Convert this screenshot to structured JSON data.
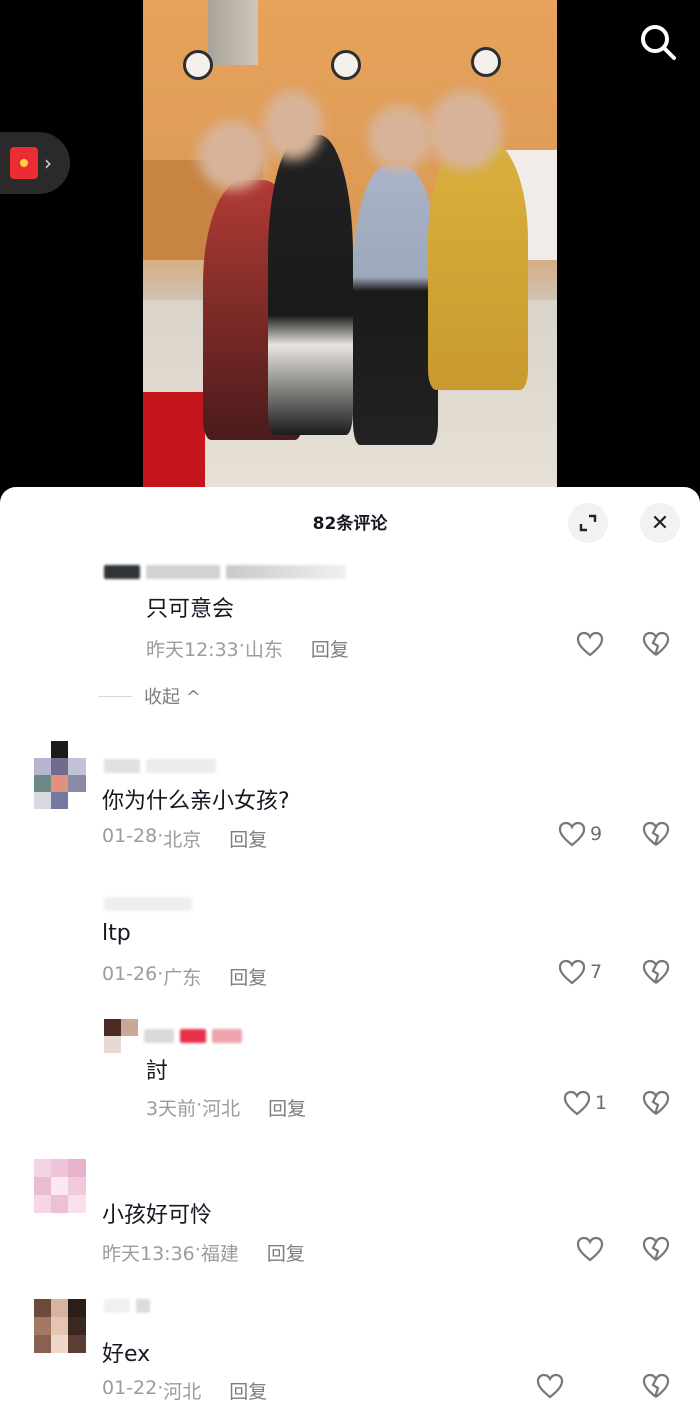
{
  "video": {
    "search_icon": "search-icon",
    "red_packet_icon": "red-envelope-icon"
  },
  "sheet": {
    "title": "82条评论",
    "expand_icon": "expand-icon",
    "close_icon": "close-icon",
    "close_glyph": "✕",
    "collapse_label": "收起 ^"
  },
  "comments": [
    {
      "text": "只可意会",
      "time": "昨天12:33",
      "location": "山东",
      "reply": "回复",
      "likes": ""
    },
    {
      "text": "你为什么亲小女孩?",
      "time": "01-28",
      "location": "北京",
      "reply": "回复",
      "likes": "9"
    },
    {
      "text": "ltp",
      "time": "01-26",
      "location": "广东",
      "reply": "回复",
      "likes": "7"
    },
    {
      "text": "討",
      "time": "3天前",
      "location": "河北",
      "reply": "回复",
      "likes": "1"
    },
    {
      "text": "小孩好可怜",
      "time": "昨天13:36",
      "location": "福建",
      "reply": "回复",
      "likes": ""
    },
    {
      "text": "好ex",
      "time": "01-22",
      "location": "河北",
      "reply": "回复",
      "likes": ""
    }
  ],
  "meta_sep": " · ",
  "colors": {
    "sheet_bg": "#ffffff",
    "text": "#161823",
    "meta": "#9b9ba0",
    "red": "#ea2d33"
  }
}
